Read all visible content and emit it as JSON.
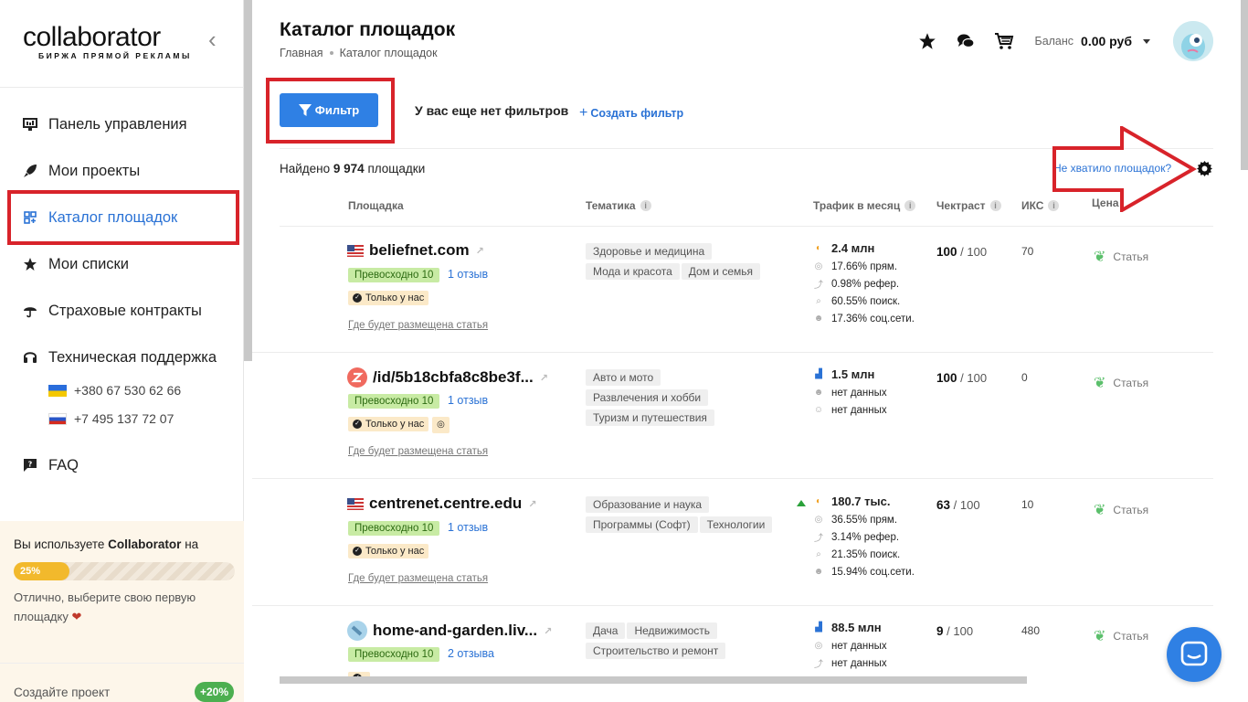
{
  "sidebar": {
    "logo": "collaborator",
    "logo_sub": "БИРЖА ПРЯМОЙ РЕКЛАМЫ",
    "items": [
      {
        "label": "Панель управления",
        "icon": "dashboard-icon"
      },
      {
        "label": "Мои проекты",
        "icon": "rocket-icon"
      },
      {
        "label": "Каталог площадок",
        "icon": "catalog-icon"
      },
      {
        "label": "Мои списки",
        "icon": "star-icon"
      },
      {
        "label": "Страховые контракты",
        "icon": "umbrella-icon"
      },
      {
        "label": "Техническая поддержка",
        "icon": "headset-icon"
      },
      {
        "label": "FAQ",
        "icon": "faq-icon"
      }
    ],
    "phones": [
      "+380 67 530 62 66",
      "+7 495 137 72 07"
    ],
    "promo": {
      "text_prefix": "Вы используете ",
      "text_brand": "Collaborator",
      "text_suffix": " на",
      "progress_label": "25%",
      "progress": 0.25,
      "hint": "Отлично, выберите свою первую площадку"
    },
    "bottom": {
      "label": "Создайте проект",
      "bonus": "+20%"
    }
  },
  "header": {
    "title": "Каталог площадок",
    "breadcrumb": [
      "Главная",
      "Каталог площадок"
    ],
    "balance_label": "Баланс",
    "balance_value": "0.00 руб"
  },
  "filters": {
    "button": "Фильтр",
    "no_filters": "У вас еще нет фильтров",
    "create": "Создать фильтр"
  },
  "results": {
    "found_prefix": "Найдено ",
    "found_count": "9 974",
    "found_suffix": " площадки",
    "not_enough": "Не хватило площадок?"
  },
  "table": {
    "columns": [
      "Площадка",
      "Тематика",
      "Трафик в месяц",
      "Чектраст",
      "ИКС",
      "Цена"
    ],
    "rows": [
      {
        "site": "beliefnet.com",
        "rating": "Превосходно 10",
        "reviews": "1 отзыв",
        "only": "Только у нас",
        "where": "Где будет размещена статья",
        "tags": [
          "Здоровье и медицина",
          "Мода и красота",
          "Дом и семья"
        ],
        "traffic": "2.4 млн",
        "traffic_lines": [
          "17.66% прям.",
          "0.98% рефер.",
          "60.55% поиск.",
          "17.36% соц.сети."
        ],
        "chek": "100",
        "chek_max": "/ 100",
        "iks": "70",
        "price": "Статья"
      },
      {
        "site": "/id/5b18cbfa8c8be3f...",
        "rating": "Превосходно 10",
        "reviews": "1 отзыв",
        "only": "Только у нас",
        "where": "Где будет размещена статья",
        "tags": [
          "Авто и мото",
          "Развлечения и хобби",
          "Туризм и путешествия"
        ],
        "traffic": "1.5 млн",
        "traffic_lines": [
          "нет данных",
          "нет данных"
        ],
        "chek": "100",
        "chek_max": "/ 100",
        "iks": "0",
        "price": "Статья"
      },
      {
        "site": "centrenet.centre.edu",
        "rating": "Превосходно 10",
        "reviews": "1 отзыв",
        "only": "Только у нас",
        "where": "Где будет размещена статья",
        "tags": [
          "Образование и наука",
          "Программы (Софт)",
          "Технологии"
        ],
        "traffic": "180.7 тыс.",
        "traffic_lines": [
          "36.55% прям.",
          "3.14% рефер.",
          "21.35% поиск.",
          "15.94% соц.сети."
        ],
        "chek": "63",
        "chek_max": "/ 100",
        "iks": "10",
        "price": "Статья"
      },
      {
        "site": "home-and-garden.liv...",
        "rating": "Превосходно 10",
        "reviews": "2 отзыва",
        "only": "",
        "where": "",
        "tags": [
          "Дача",
          "Недвижимость",
          "Строительство и ремонт"
        ],
        "traffic": "88.5 млн",
        "traffic_lines": [
          "нет данных",
          "нет данных"
        ],
        "chek": "9",
        "chek_max": "/ 100",
        "iks": "480",
        "price": "Статья"
      }
    ]
  },
  "colors": {
    "accent": "#2f80e4",
    "annotation": "#d8232a",
    "active": "#2a72d5"
  }
}
